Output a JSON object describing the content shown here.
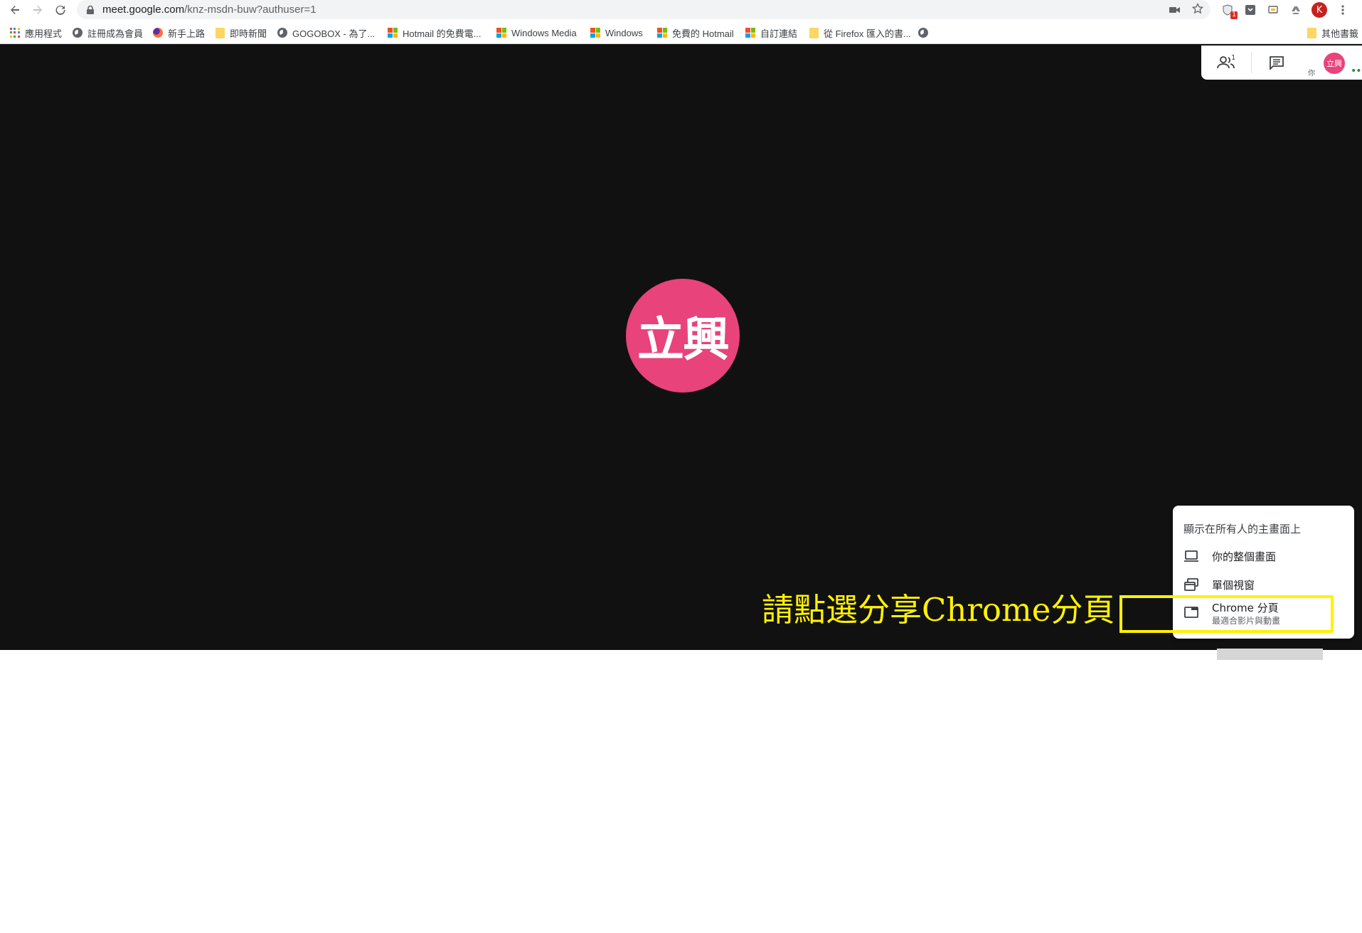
{
  "browser": {
    "url_host": "meet.google.com",
    "url_path": "/knz-msdn-buw?authuser=1",
    "extension_badge": "1",
    "profile_initial": "K"
  },
  "bookmarks": [
    {
      "label": "應用程式",
      "icon": "apps-grid-icon"
    },
    {
      "label": "註冊成為會員",
      "icon": "globe-icon"
    },
    {
      "label": "新手上路",
      "icon": "firefox-icon"
    },
    {
      "label": "即時新聞",
      "icon": "folder-icon"
    },
    {
      "label": "GOGOBOX - 為了...",
      "icon": "globe-icon"
    },
    {
      "label": "Hotmail 的免費電...",
      "icon": "microsoft-icon"
    },
    {
      "label": "Windows Media",
      "icon": "microsoft-icon"
    },
    {
      "label": "Windows",
      "icon": "microsoft-icon"
    },
    {
      "label": "免費的 Hotmail",
      "icon": "microsoft-icon"
    },
    {
      "label": "自訂連結",
      "icon": "microsoft-icon"
    },
    {
      "label": "從 Firefox 匯入的書...",
      "icon": "folder-icon"
    },
    {
      "label": "",
      "icon": "globe-icon"
    }
  ],
  "other_bookmarks": "其他書籤",
  "meet": {
    "participant_initials": "立興",
    "people_count": "1",
    "you_label": "你",
    "self_avatar_initials": "立興"
  },
  "present_menu": {
    "header": "顯示在所有人的主畫面上",
    "items": [
      {
        "label": "你的整個畫面",
        "sublabel": "",
        "icon": "laptop-icon"
      },
      {
        "label": "單個視窗",
        "sublabel": "",
        "icon": "window-icon"
      },
      {
        "label": "Chrome 分頁",
        "sublabel": "最適合影片與動畫",
        "icon": "tab-icon"
      }
    ]
  },
  "annotation": {
    "text": "請點選分享Chrome分頁",
    "color": "#fff200"
  },
  "colors": {
    "stage_bg": "#111111",
    "avatar_pink": "#e8437a",
    "annotation_yellow": "#fff200"
  }
}
